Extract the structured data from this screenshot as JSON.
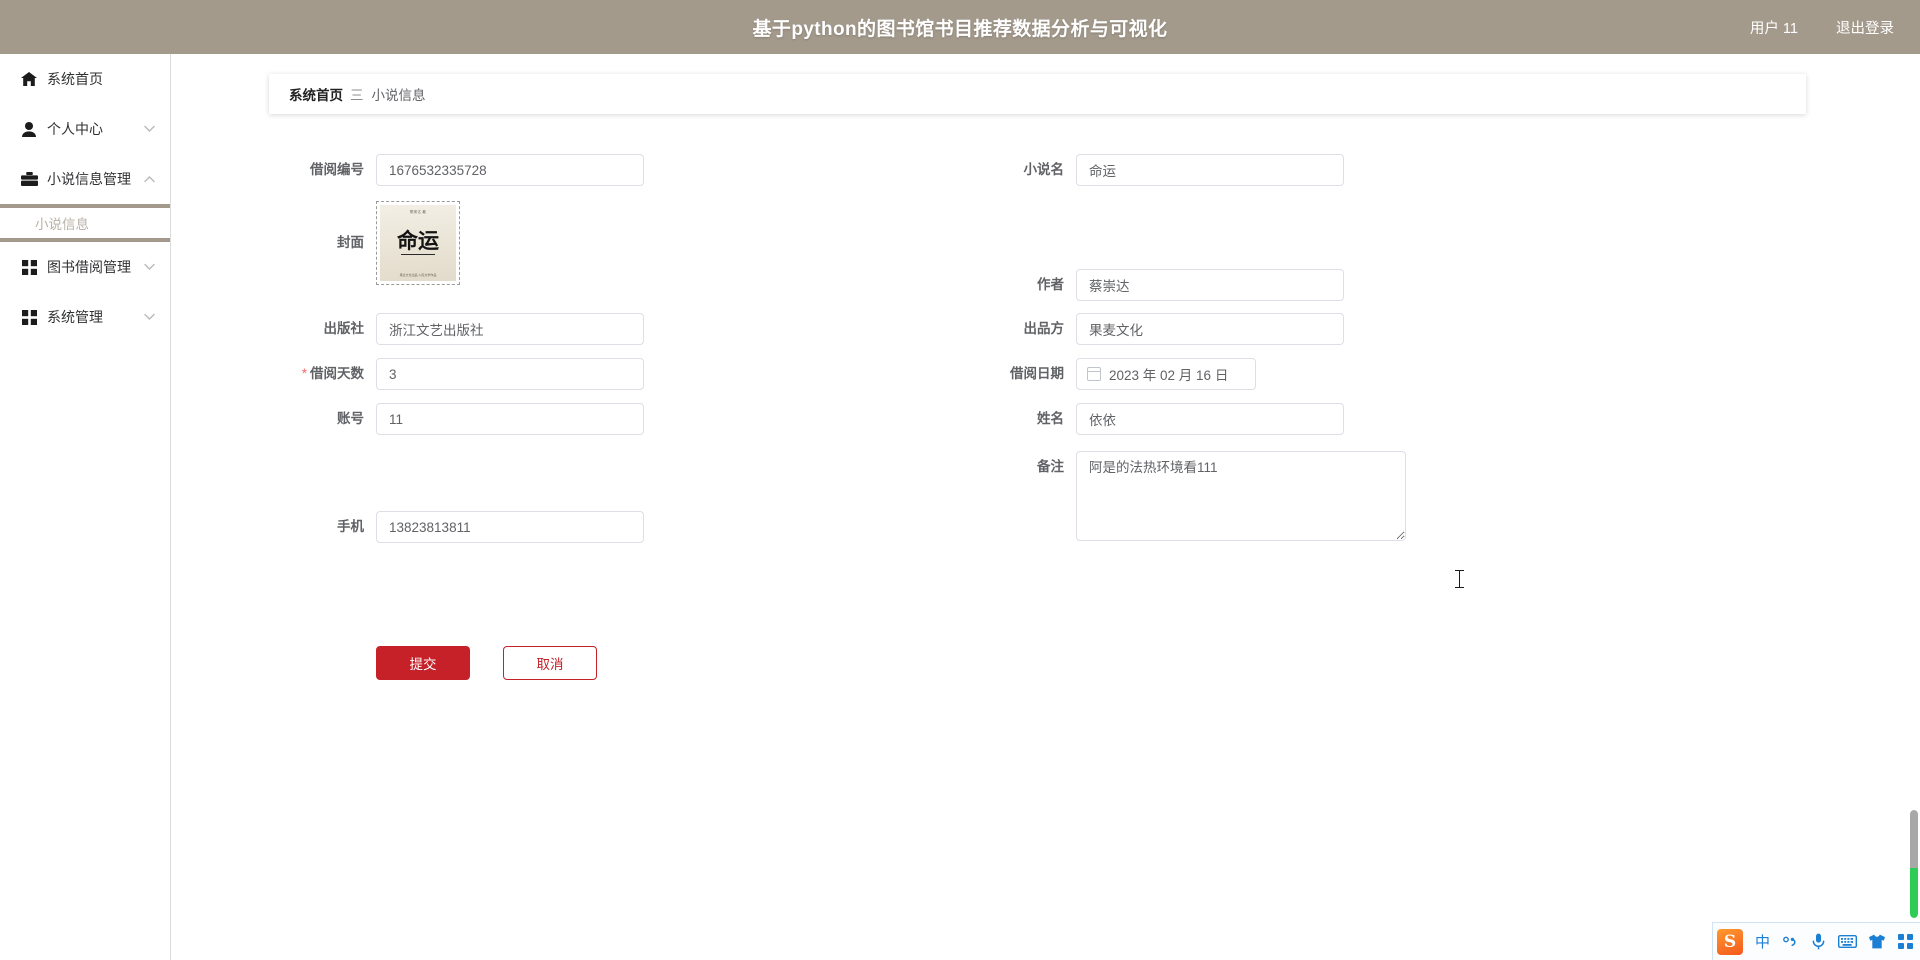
{
  "header": {
    "title": "基于python的图书馆书目推荐数据分析与可视化",
    "user_label": "用户 11",
    "logout_label": "退出登录",
    "bg_color": "#a39a8c"
  },
  "sidebar": {
    "items": [
      {
        "label": "系统首页",
        "icon": "home-icon",
        "caret": "",
        "active": false
      },
      {
        "label": "个人中心",
        "icon": "user-icon",
        "caret": "chevron-down-icon",
        "active": false
      },
      {
        "label": "小说信息管理",
        "icon": "briefcase-icon",
        "caret": "chevron-up-icon",
        "active": true
      },
      {
        "label": "图书借阅管理",
        "icon": "grid-icon",
        "caret": "chevron-down-icon",
        "active": false
      },
      {
        "label": "系统管理",
        "icon": "grid-icon",
        "caret": "chevron-down-icon",
        "active": false
      }
    ],
    "submenu": {
      "label": "小说信息",
      "parent": "小说信息管理",
      "active": true
    }
  },
  "breadcrumb": {
    "home": "系统首页",
    "separator": "三",
    "current": "小说信息"
  },
  "form": {
    "left": {
      "borrow_no": {
        "label": "借阅编号",
        "value": "1676532335728",
        "placeholder": "借阅编号"
      },
      "cover": {
        "label": "封面",
        "image_title": "命运",
        "image_top_text": "蔡崇达 著",
        "image_bottom_text": "果麦文化出品  人民文学作品"
      },
      "publisher": {
        "label": "出版社",
        "value": "浙江文艺出版社",
        "placeholder": "出版社"
      },
      "borrow_days": {
        "label": "借阅天数",
        "value": "3",
        "placeholder": "借阅天数",
        "required": true,
        "required_mark": "*"
      },
      "account": {
        "label": "账号",
        "value": "11",
        "placeholder": "账号"
      },
      "phone": {
        "label": "手机",
        "value": "13823813811",
        "placeholder": "手机"
      }
    },
    "right": {
      "novel_name": {
        "label": "小说名",
        "value": "命运",
        "placeholder": "小说名"
      },
      "author": {
        "label": "作者",
        "value": "蔡崇达",
        "placeholder": "作者"
      },
      "producer": {
        "label": "出品方",
        "value": "果麦文化",
        "placeholder": "出品方"
      },
      "borrow_date": {
        "label": "借阅日期",
        "value": "2023 年 02 月 16 日",
        "icon": "calendar-icon"
      },
      "name": {
        "label": "姓名",
        "value": "依依",
        "placeholder": "姓名"
      },
      "remark": {
        "label": "备注",
        "value": "阿是的法热环境看111",
        "placeholder": "备注"
      }
    },
    "buttons": {
      "submit": {
        "label": "提交",
        "color": "#c62129"
      },
      "cancel": {
        "label": "取消",
        "color": "#c62129"
      }
    }
  },
  "ime": {
    "logo": "S",
    "items": [
      {
        "name": "chinese-mode-icon",
        "glyph": "中"
      },
      {
        "name": "punctuation-icon",
        "glyph": "°,"
      },
      {
        "name": "microphone-icon",
        "glyph": ""
      },
      {
        "name": "keyboard-icon",
        "glyph": ""
      },
      {
        "name": "skin-icon",
        "glyph": ""
      },
      {
        "name": "toolbox-grid-icon",
        "glyph": ""
      }
    ]
  },
  "scrollbar": {
    "track_color": "#a8a8a8",
    "thumb_color": "#2ecc55"
  }
}
